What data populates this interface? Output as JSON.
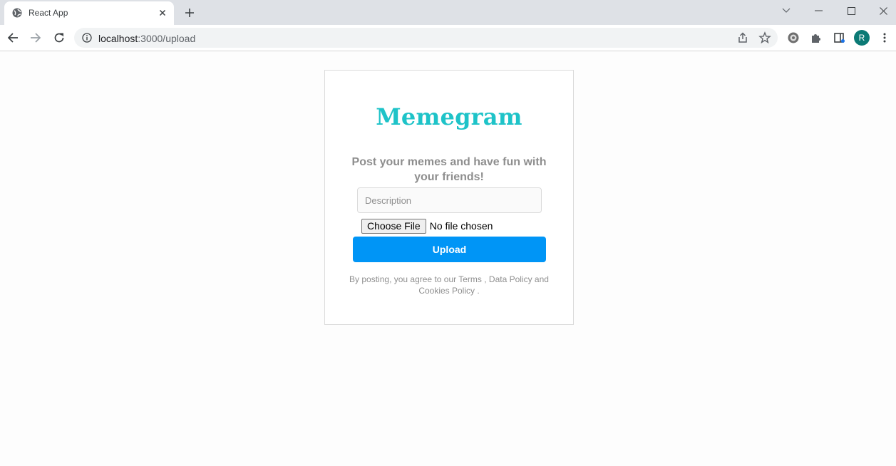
{
  "browser": {
    "tab_title": "React App",
    "url_host": "localhost",
    "url_path": ":3000/upload",
    "profile_initial": "R",
    "colors": {
      "tabstrip": "#dee1e6",
      "avatar": "#0b7a75"
    },
    "icons": [
      "globe-icon",
      "close-icon",
      "plus-icon",
      "back-icon",
      "forward-icon",
      "reload-icon",
      "info-icon",
      "share-icon",
      "star-icon",
      "extension-icon",
      "puzzle-icon",
      "reading-list-icon",
      "menu-icon"
    ]
  },
  "page": {
    "logo": "Memegram",
    "tagline": "Post your memes and have fun with your friends!",
    "description_placeholder": "Description",
    "choose_file_label": "Choose File",
    "file_status": "No file chosen",
    "upload_label": "Upload",
    "terms_text": "By posting, you agree to our Terms , Data Policy and Cookies Policy .",
    "colors": {
      "logo": "#1ec3c8",
      "upload_button": "#0095f6",
      "muted_text": "#8e8e8e"
    }
  }
}
